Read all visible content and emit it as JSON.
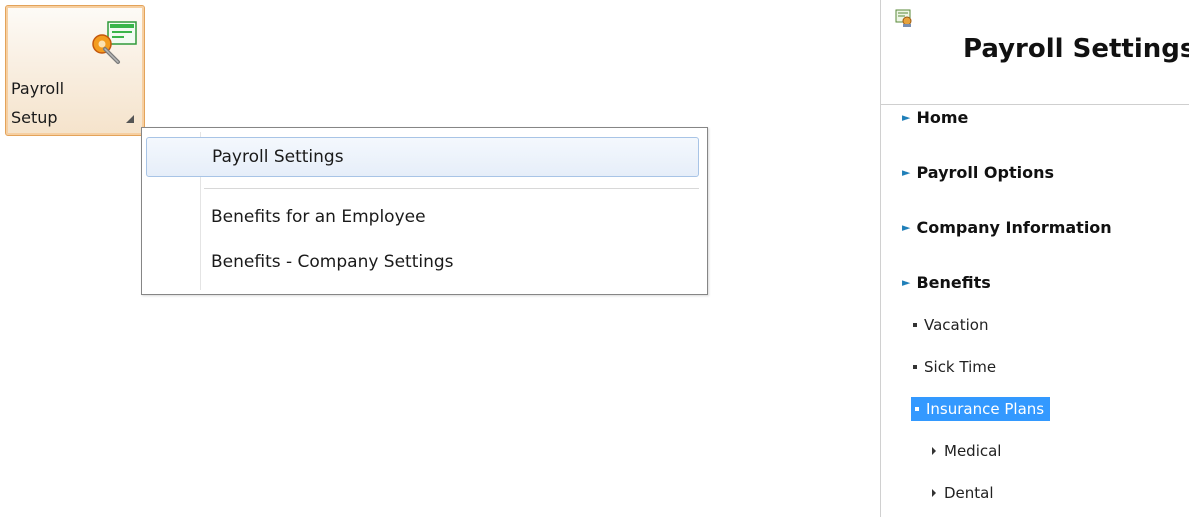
{
  "ribbon": {
    "label_line1": "Payroll",
    "label_line2": "Setup",
    "icon": "payroll-setup-icon"
  },
  "menu": {
    "items": [
      {
        "label": "Payroll Settings",
        "highlighted": true
      },
      {
        "label": "Benefits for an Employee"
      },
      {
        "label": "Benefits - Company Settings"
      }
    ]
  },
  "panel": {
    "title": "Payroll Settings",
    "icon": "payroll-settings-icon",
    "nav": {
      "home": "Home",
      "payroll_options": "Payroll Options",
      "company_information": "Company Information",
      "benefits": "Benefits",
      "vacation": "Vacation",
      "sick_time": "Sick Time",
      "insurance_plans": "Insurance Plans",
      "medical": "Medical",
      "dental": "Dental"
    },
    "selected_item": "Insurance Plans",
    "colors": {
      "chevron": "#1f7fb9",
      "selection": "#3399ff"
    }
  }
}
